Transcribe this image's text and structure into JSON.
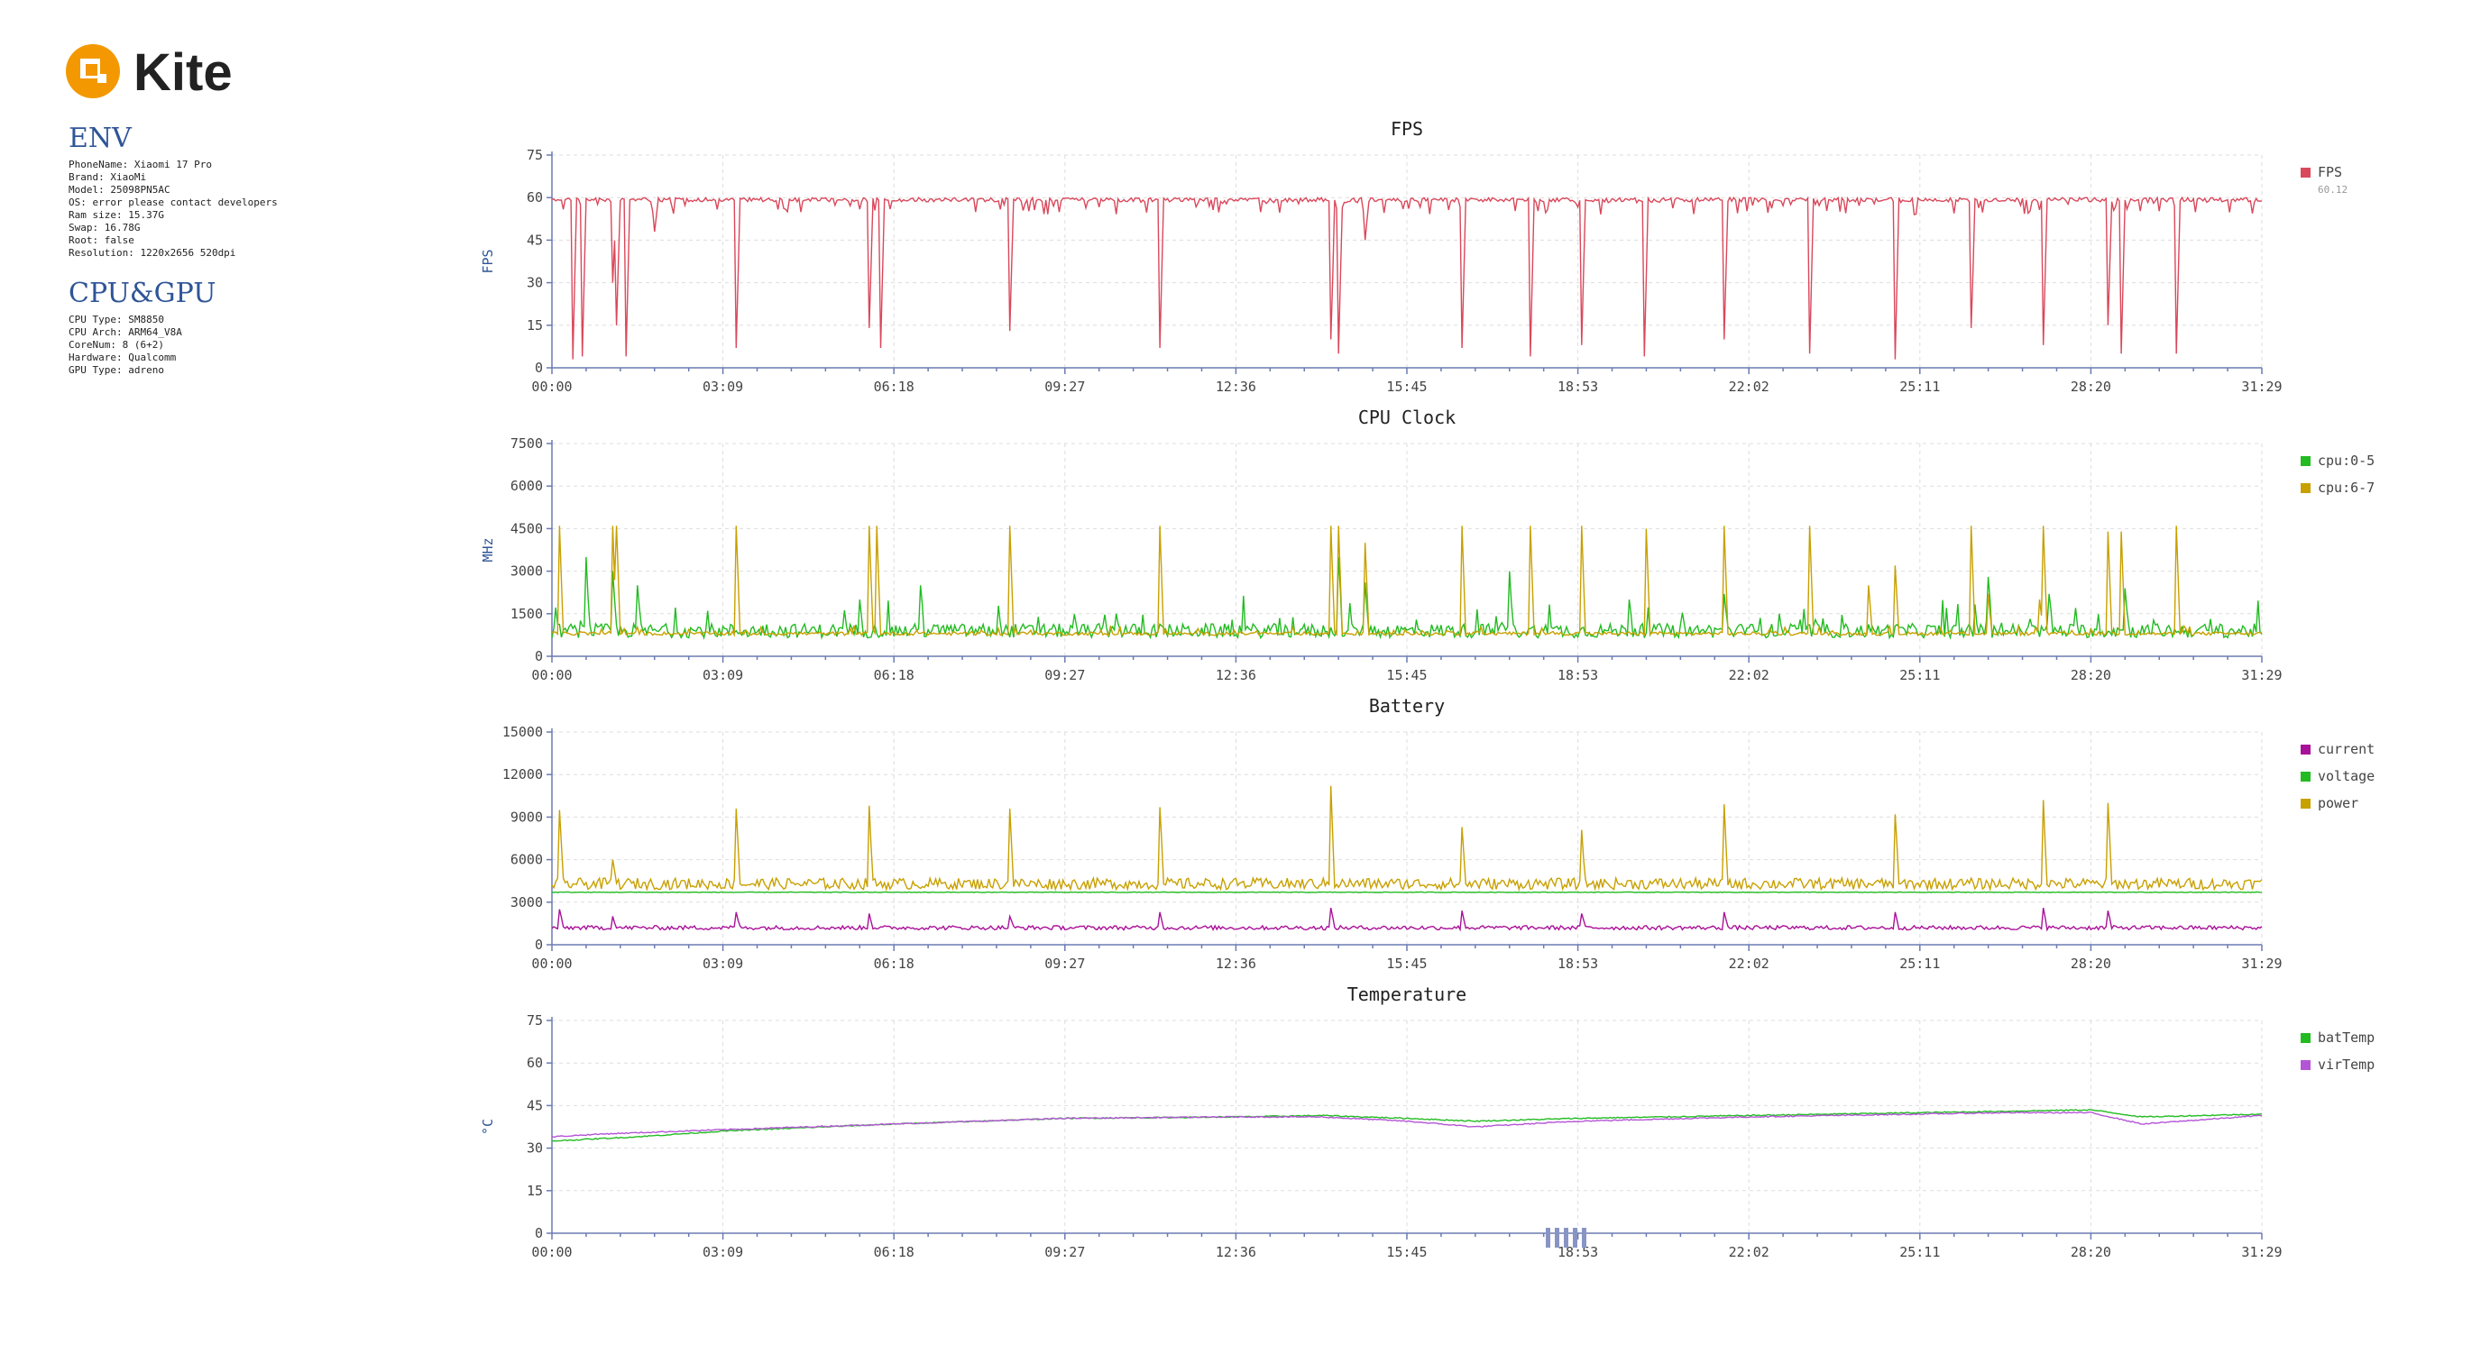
{
  "brand": {
    "name": "Kite",
    "color": "#f39800"
  },
  "env": {
    "title": "ENV",
    "lines": [
      "PhoneName: Xiaomi 17 Pro",
      "Brand: XiaoMi",
      "Model: 25098PN5AC",
      "OS: error please contact developers",
      "Ram size: 15.37G",
      "Swap: 16.78G",
      "Root: false",
      "Resolution: 1220x2656 520dpi"
    ]
  },
  "cpu_gpu": {
    "title": "CPU&GPU",
    "lines": [
      "CPU Type: SM8850",
      "CPU Arch: ARM64_V8A",
      "CoreNum: 8 (6+2)",
      "Hardware: Qualcomm",
      "GPU Type: adreno"
    ]
  },
  "x_ticks": [
    "00:00",
    "03:09",
    "06:18",
    "09:27",
    "12:36",
    "15:45",
    "18:53",
    "22:02",
    "25:11",
    "28:20",
    "31:29"
  ],
  "chart_data": [
    {
      "type": "line",
      "title": "FPS",
      "ylabel": "FPS",
      "ylim": [
        0,
        75
      ],
      "yticks": [
        0,
        15,
        30,
        45,
        60,
        75
      ],
      "grid": true,
      "legend_position": "right",
      "series": [
        {
          "name": "FPS",
          "color": "#d9485b",
          "sub": "60.12",
          "base": 60,
          "noise": 1.5,
          "spikes": [
            [
              0.012,
              3
            ],
            [
              0.018,
              4
            ],
            [
              0.035,
              30
            ],
            [
              0.038,
              15
            ],
            [
              0.043,
              4
            ],
            [
              0.06,
              48
            ],
            [
              0.108,
              7
            ],
            [
              0.185,
              14
            ],
            [
              0.192,
              7
            ],
            [
              0.268,
              13
            ],
            [
              0.356,
              7
            ],
            [
              0.456,
              10
            ],
            [
              0.46,
              5
            ],
            [
              0.475,
              45
            ],
            [
              0.532,
              7
            ],
            [
              0.572,
              4
            ],
            [
              0.602,
              8
            ],
            [
              0.639,
              4
            ],
            [
              0.685,
              10
            ],
            [
              0.735,
              5
            ],
            [
              0.785,
              3
            ],
            [
              0.83,
              14
            ],
            [
              0.872,
              8
            ],
            [
              0.91,
              15
            ],
            [
              0.918,
              5
            ],
            [
              0.95,
              5
            ]
          ]
        }
      ]
    },
    {
      "type": "line",
      "title": "CPU Clock",
      "ylabel": "MHz",
      "ylim": [
        0,
        7500
      ],
      "yticks": [
        0,
        1500,
        3000,
        4500,
        6000,
        7500
      ],
      "grid": true,
      "legend_position": "right",
      "series": [
        {
          "name": "cpu:0-5",
          "color": "#22bb22",
          "base": 900,
          "noise": 250,
          "spikes": [
            [
              0.02,
              3500
            ],
            [
              0.035,
              3000
            ],
            [
              0.05,
              2500
            ],
            [
              0.18,
              2000
            ],
            [
              0.215,
              2500
            ],
            [
              0.33,
              1500
            ],
            [
              0.46,
              3500
            ],
            [
              0.475,
              2600
            ],
            [
              0.56,
              3000
            ],
            [
              0.63,
              2000
            ],
            [
              0.685,
              2200
            ],
            [
              0.84,
              2800
            ],
            [
              0.875,
              2200
            ],
            [
              0.92,
              2400
            ]
          ]
        },
        {
          "name": "cpu:6-7",
          "color": "#c8a000",
          "base": 800,
          "noise": 60,
          "spikes": [
            [
              0.004,
              4600
            ],
            [
              0.035,
              4600
            ],
            [
              0.038,
              4600
            ],
            [
              0.108,
              4600
            ],
            [
              0.185,
              4600
            ],
            [
              0.19,
              4600
            ],
            [
              0.268,
              4600
            ],
            [
              0.356,
              4600
            ],
            [
              0.455,
              4600
            ],
            [
              0.46,
              4600
            ],
            [
              0.475,
              4000
            ],
            [
              0.532,
              4600
            ],
            [
              0.572,
              4600
            ],
            [
              0.602,
              4600
            ],
            [
              0.64,
              4500
            ],
            [
              0.686,
              4600
            ],
            [
              0.735,
              4600
            ],
            [
              0.77,
              2500
            ],
            [
              0.785,
              3200
            ],
            [
              0.83,
              4600
            ],
            [
              0.84,
              2200
            ],
            [
              0.87,
              2000
            ],
            [
              0.872,
              4600
            ],
            [
              0.91,
              4400
            ],
            [
              0.918,
              4400
            ],
            [
              0.95,
              4600
            ]
          ]
        }
      ]
    },
    {
      "type": "line",
      "title": "Battery",
      "ylabel": "",
      "ylim": [
        0,
        15000
      ],
      "yticks": [
        0,
        3000,
        6000,
        9000,
        12000,
        15000
      ],
      "grid": true,
      "legend_position": "right",
      "series": [
        {
          "name": "current",
          "color": "#aa1199",
          "base": 1200,
          "noise": 150,
          "spikes": [
            [
              0.004,
              2500
            ],
            [
              0.035,
              2000
            ],
            [
              0.108,
              2300
            ],
            [
              0.185,
              2200
            ],
            [
              0.268,
              2000
            ],
            [
              0.356,
              2300
            ],
            [
              0.455,
              2600
            ],
            [
              0.532,
              2400
            ],
            [
              0.602,
              2200
            ],
            [
              0.685,
              2300
            ],
            [
              0.785,
              2300
            ],
            [
              0.872,
              2600
            ],
            [
              0.91,
              2400
            ]
          ]
        },
        {
          "name": "voltage",
          "color": "#22bb22",
          "base": 3700,
          "noise": 20,
          "spikes": []
        },
        {
          "name": "power",
          "color": "#c8a000",
          "base": 4300,
          "noise": 400,
          "spikes": [
            [
              0.004,
              9500
            ],
            [
              0.035,
              6000
            ],
            [
              0.108,
              9600
            ],
            [
              0.185,
              9800
            ],
            [
              0.268,
              9600
            ],
            [
              0.356,
              9700
            ],
            [
              0.455,
              11200
            ],
            [
              0.532,
              8300
            ],
            [
              0.602,
              8100
            ],
            [
              0.685,
              9900
            ],
            [
              0.785,
              9200
            ],
            [
              0.872,
              10200
            ],
            [
              0.91,
              10000
            ]
          ]
        }
      ]
    },
    {
      "type": "line",
      "title": "Temperature",
      "ylabel": "°C",
      "ylim": [
        0,
        75
      ],
      "yticks": [
        0,
        15,
        30,
        45,
        60,
        75
      ],
      "grid": true,
      "legend_position": "right",
      "series": [
        {
          "name": "batTemp",
          "color": "#22bb22",
          "points": [
            [
              0,
              32.5
            ],
            [
              0.05,
              34
            ],
            [
              0.1,
              36
            ],
            [
              0.2,
              38.5
            ],
            [
              0.3,
              40.5
            ],
            [
              0.4,
              41
            ],
            [
              0.45,
              41.5
            ],
            [
              0.5,
              40.5
            ],
            [
              0.54,
              39.5
            ],
            [
              0.6,
              40.5
            ],
            [
              0.7,
              41.5
            ],
            [
              0.8,
              42.5
            ],
            [
              0.85,
              43
            ],
            [
              0.9,
              43.5
            ],
            [
              0.93,
              41
            ],
            [
              1,
              42
            ]
          ]
        },
        {
          "name": "virTemp",
          "color": "#b455d6",
          "points": [
            [
              0,
              34
            ],
            [
              0.03,
              35
            ],
            [
              0.1,
              36.5
            ],
            [
              0.2,
              38.5
            ],
            [
              0.3,
              40.5
            ],
            [
              0.4,
              41
            ],
            [
              0.45,
              41
            ],
            [
              0.5,
              39.5
            ],
            [
              0.54,
              37.5
            ],
            [
              0.6,
              39.5
            ],
            [
              0.7,
              41
            ],
            [
              0.8,
              42
            ],
            [
              0.85,
              42.5
            ],
            [
              0.9,
              42.5
            ],
            [
              0.93,
              38.5
            ],
            [
              1,
              41.5
            ]
          ]
        }
      ]
    }
  ]
}
